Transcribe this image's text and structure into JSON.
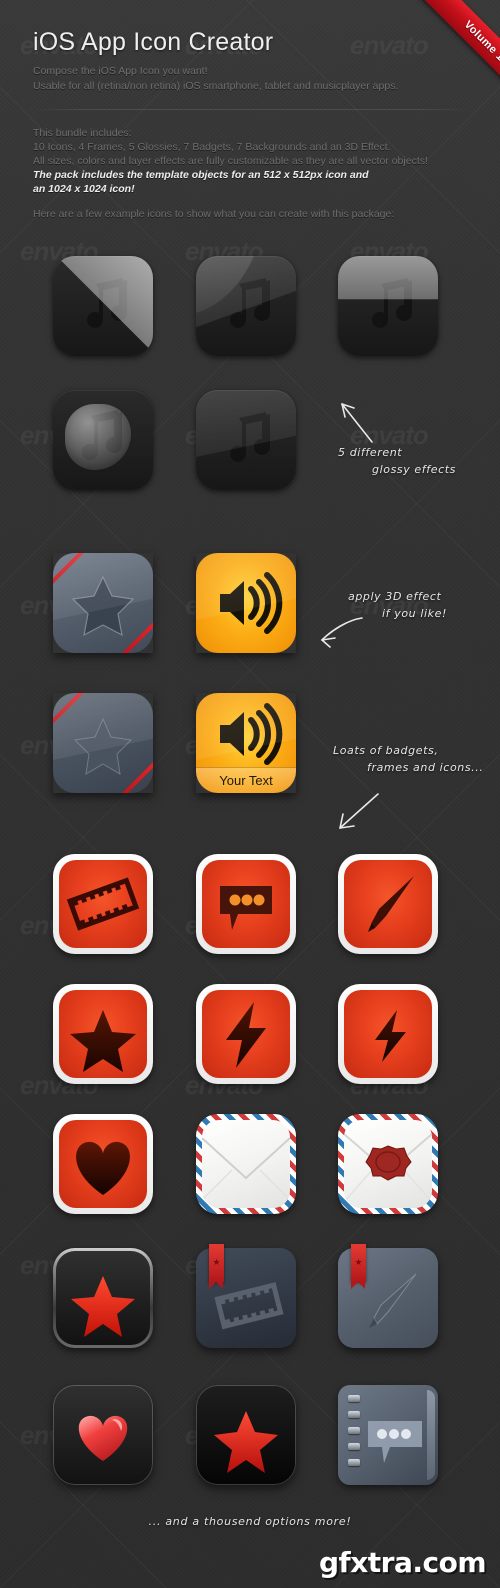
{
  "ribbon": {
    "label": "Volume 1",
    "color": "#c4101a"
  },
  "header": {
    "title": "iOS App Icon Creator",
    "sub_line1": "Compose the iOS App Icon you want!",
    "sub_line2": "Usable for all (retina/non retina) iOS smartphone, tablet and musicplayer apps."
  },
  "bundle": {
    "line1": "This bundle includes:",
    "line2": "10 Icons, 4 Frames, 5 Glossies, 7 Badgets, 7 Backgrounds and an 3D Effect.",
    "line3": "All sizes, colors and layer effects are fully customizable as they are all vector objects!",
    "line4": "The pack includes the template objects for an 512 x 512px icon and",
    "line5": "an 1024 x 1024 icon!"
  },
  "lead": "Here are a few example icons to show what you can create with this package:",
  "annotations": {
    "glossy_l1": "5 different",
    "glossy_l2": "glossy effects",
    "threed_l1": "apply 3D effect",
    "threed_l2": "if you like!",
    "badgets_l1": "Loats of badgets,",
    "badgets_l2": "frames and icons..."
  },
  "icons": {
    "row1": [
      {
        "name": "music-note-diagonal-gloss",
        "label": "Music note icon, diagonal gloss"
      },
      {
        "name": "music-note-curve-gloss",
        "label": "Music note icon, curved gloss"
      },
      {
        "name": "music-note-half-gloss",
        "label": "Music note icon, half gloss"
      }
    ],
    "row2": [
      {
        "name": "music-note-circle-gloss",
        "label": "Music note icon, circle gloss"
      },
      {
        "name": "music-note-soft-gloss",
        "label": "Music note icon, soft gloss"
      }
    ],
    "row3": [
      {
        "name": "star-slate-3d-striped",
        "label": "Star icon slate with 3D and red stripes"
      },
      {
        "name": "speaker-orange-3d",
        "label": "Speaker icon orange with 3D"
      }
    ],
    "row4": [
      {
        "name": "star-slate-flat-striped",
        "label": "Star icon slate flat with red stripes"
      },
      {
        "name": "speaker-orange-textband",
        "label": "Speaker icon orange with text band"
      }
    ],
    "row5": [
      {
        "name": "film-strip-red-white-frame",
        "label": "Film strip icon"
      },
      {
        "name": "chat-bubble-red-white-frame",
        "label": "Chat bubble icon"
      },
      {
        "name": "brush-red-white-frame",
        "label": "Brush icon"
      }
    ],
    "row6": [
      {
        "name": "star-red-white-frame",
        "label": "Star icon"
      },
      {
        "name": "bolt-large-red-white-frame",
        "label": "Lightning bolt icon large"
      },
      {
        "name": "bolt-small-red-white-frame",
        "label": "Lightning bolt icon small"
      }
    ],
    "row7": [
      {
        "name": "heart-red-white-frame",
        "label": "Heart icon"
      },
      {
        "name": "envelope-airmail",
        "label": "Airmail envelope icon"
      },
      {
        "name": "envelope-airmail-wax-seal",
        "label": "Airmail envelope with wax seal icon"
      }
    ],
    "row8": [
      {
        "name": "star-red-metal-frame",
        "label": "Red star on black with metal frame"
      },
      {
        "name": "film-strip-slate-ribbon",
        "label": "Film strip slate with ribbon badge"
      },
      {
        "name": "brush-slate-ribbon",
        "label": "Brush slate with ribbon badge"
      }
    ],
    "row9": [
      {
        "name": "heart-glossy-dark",
        "label": "Glossy red heart on dark"
      },
      {
        "name": "star-glossy-dark",
        "label": "Glossy red star on dark"
      },
      {
        "name": "notebook-chat-bubble",
        "label": "Notebook with chat bubble"
      }
    ]
  },
  "speaker_text_band": "Your Text",
  "footer_note": "... and a thousend options more!",
  "watermark": "gfxtra.com",
  "envato_watermark": "envato"
}
